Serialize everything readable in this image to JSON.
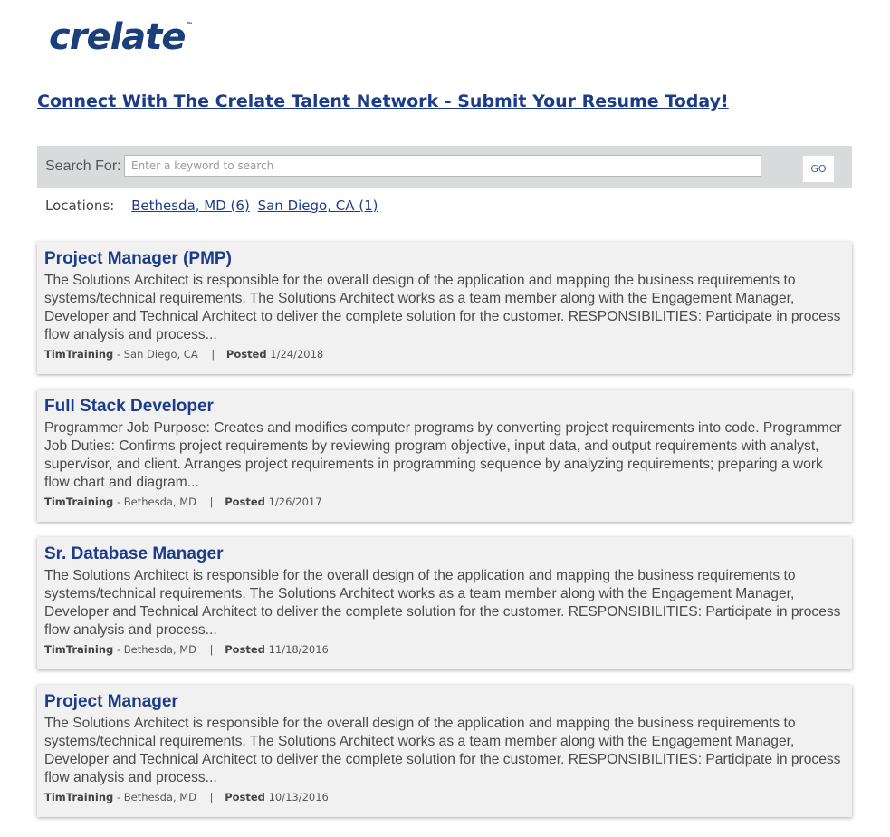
{
  "brand": {
    "logo_text": "crelate",
    "logo_tm": "™"
  },
  "headline": "Connect With The Crelate Talent Network - Submit Your Resume Today!",
  "search": {
    "label": "Search For:",
    "placeholder": "Enter a keyword to search",
    "value": "",
    "go_label": "GO"
  },
  "locations": {
    "label": "Locations:",
    "items": [
      {
        "label": "Bethesda, MD (6)"
      },
      {
        "label": "San Diego, CA (1)"
      }
    ]
  },
  "jobs": [
    {
      "title": "Project Manager (PMP)",
      "description": "The Solutions Architect is responsible for the overall design of the application and mapping the business requirements to systems/technical requirements. The Solutions Architect works as a team member along with the Engagement Manager, Developer and Technical Architect to deliver the complete solution for the customer. RESPONSIBILITIES: Participate in process flow analysis and process...",
      "company": "TimTraining",
      "location": "- San Diego, CA",
      "posted_label": "Posted",
      "posted_date": "1/24/2018"
    },
    {
      "title": "Full Stack Developer",
      "description": "Programmer Job Purpose: Creates and modifies computer programs by converting project requirements into code. Programmer Job Duties: Confirms project requirements by reviewing program objective, input data, and output requirements with analyst, supervisor, and client. Arranges project requirements in programming sequence by analyzing requirements; preparing a work flow chart and diagram...",
      "company": "TimTraining",
      "location": "- Bethesda, MD",
      "posted_label": "Posted",
      "posted_date": "1/26/2017"
    },
    {
      "title": "Sr. Database Manager",
      "description": "The Solutions Architect is responsible for the overall design of the application and mapping the business requirements to systems/technical requirements. The Solutions Architect works as a team member along with the Engagement Manager, Developer and Technical Architect to deliver the complete solution for the customer. RESPONSIBILITIES: Participate in process flow analysis and process...",
      "company": "TimTraining",
      "location": "- Bethesda, MD",
      "posted_label": "Posted",
      "posted_date": "11/18/2016"
    },
    {
      "title": "Project Manager",
      "description": "The Solutions Architect is responsible for the overall design of the application and mapping the business requirements to systems/technical requirements. The Solutions Architect works as a team member along with the Engagement Manager, Developer and Technical Architect to deliver the complete solution for the customer. RESPONSIBILITIES: Participate in process flow analysis and process...",
      "company": "TimTraining",
      "location": "- Bethesda, MD",
      "posted_label": "Posted",
      "posted_date": "10/13/2016"
    }
  ],
  "meta_separator": "|"
}
